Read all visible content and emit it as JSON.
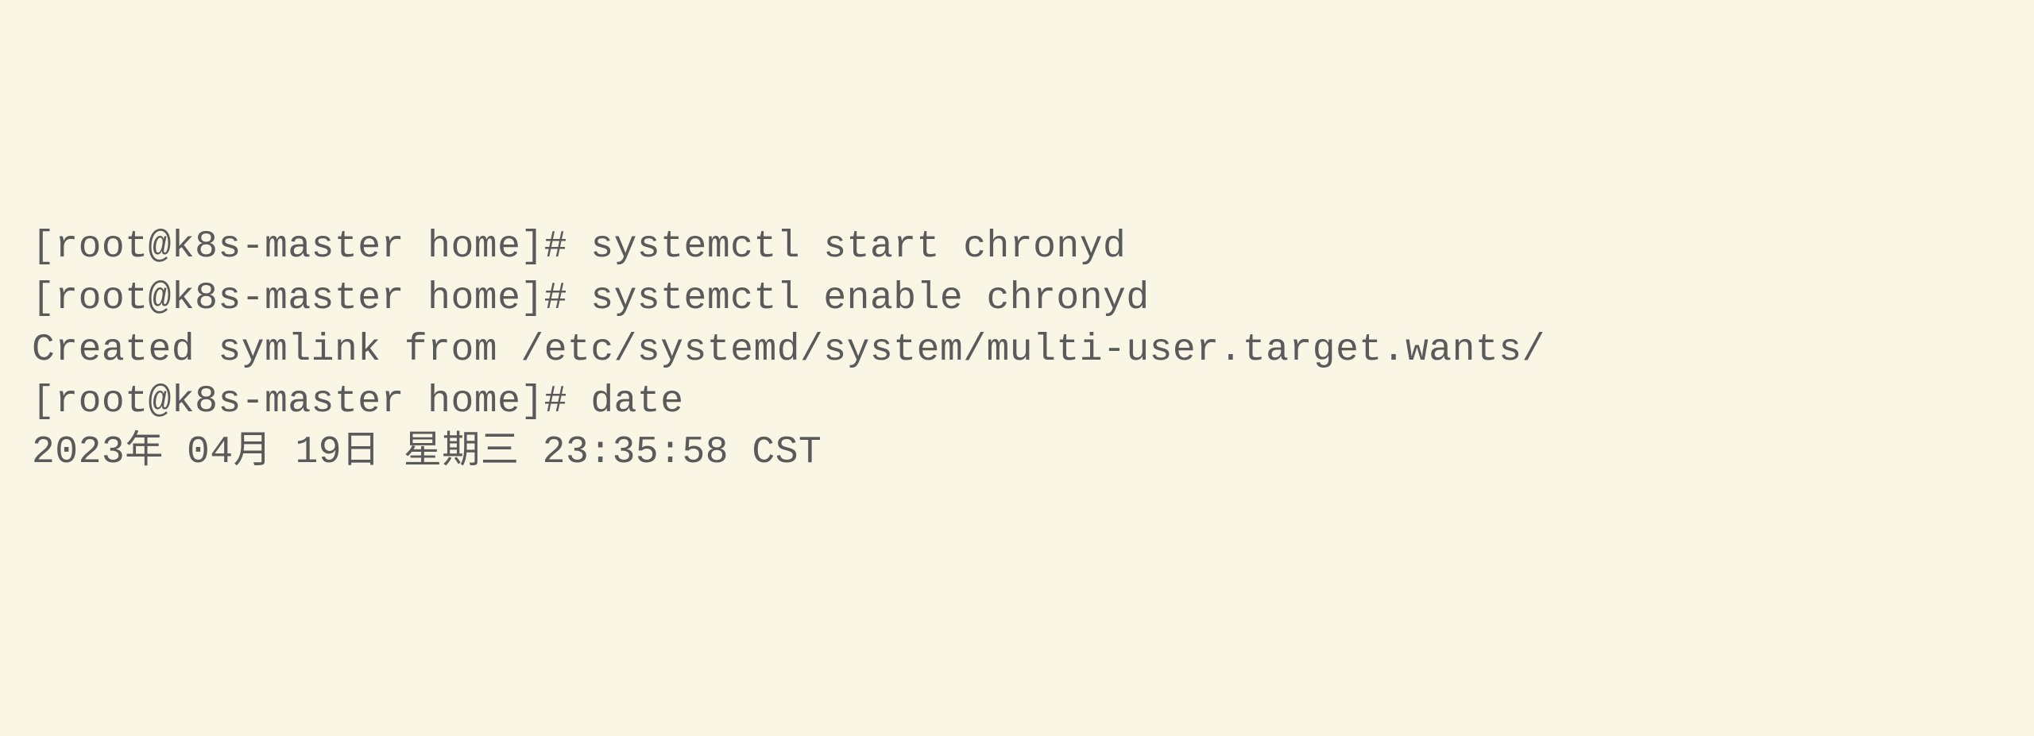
{
  "terminal": {
    "lines": [
      "[root@k8s-master home]# systemctl start chronyd",
      "[root@k8s-master home]# systemctl enable chronyd",
      "Created symlink from /etc/systemd/system/multi-user.target.wants/",
      "[root@k8s-master home]# date",
      "2023年 04月 19日 星期三 23:35:58 CST"
    ]
  }
}
